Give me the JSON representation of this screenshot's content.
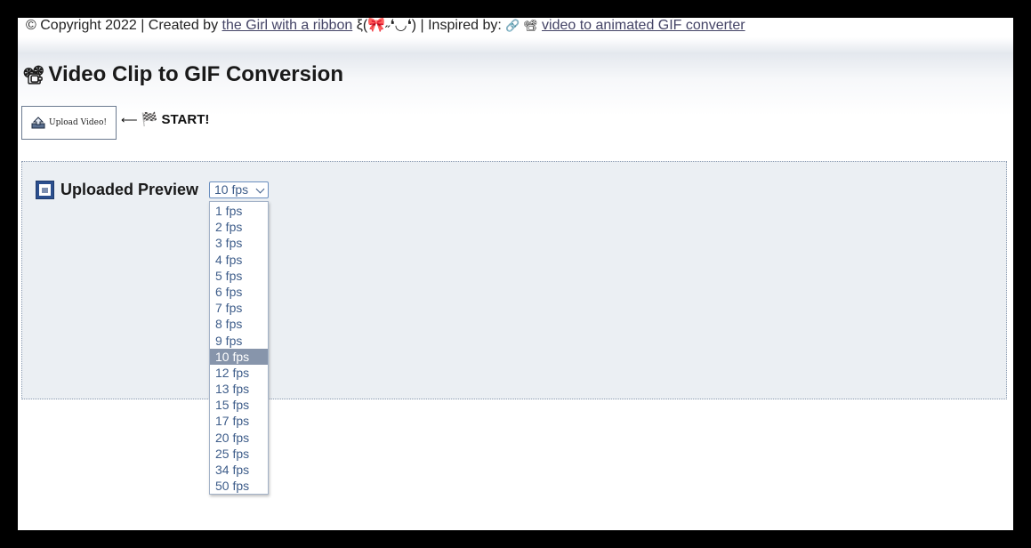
{
  "header": {
    "copyright_prefix": "© Copyright 2022 | Created by",
    "author_link": "the Girl with a ribbon",
    "author_suffix": "ξ(🎀˶❛◡❛) | Inspired by:",
    "inspired_icons": "🔗 📽",
    "inspired_link": "video to animated GIF converter"
  },
  "title": {
    "icon": "film-projector-icon",
    "icon_glyph": "📽",
    "text": "Video Clip to GIF Conversion"
  },
  "upload": {
    "icon": "upload-tray-icon",
    "label": "Upload Video!"
  },
  "start": {
    "arrow": "⟵",
    "flag_icon": "🏁",
    "text": "START!"
  },
  "preview": {
    "icon": "framed-picture-icon",
    "title": "Uploaded Preview",
    "fps_selected": "10 fps",
    "fps_options": [
      "1 fps",
      "2 fps",
      "3 fps",
      "4 fps",
      "5 fps",
      "6 fps",
      "7 fps",
      "8 fps",
      "9 fps",
      "10 fps",
      "12 fps",
      "13 fps",
      "15 fps",
      "17 fps",
      "20 fps",
      "25 fps",
      "34 fps",
      "50 fps"
    ]
  },
  "colors": {
    "panel_bg": "#ebeff3",
    "option_text": "#3e5d8a",
    "selected_bg": "#8795ab"
  }
}
